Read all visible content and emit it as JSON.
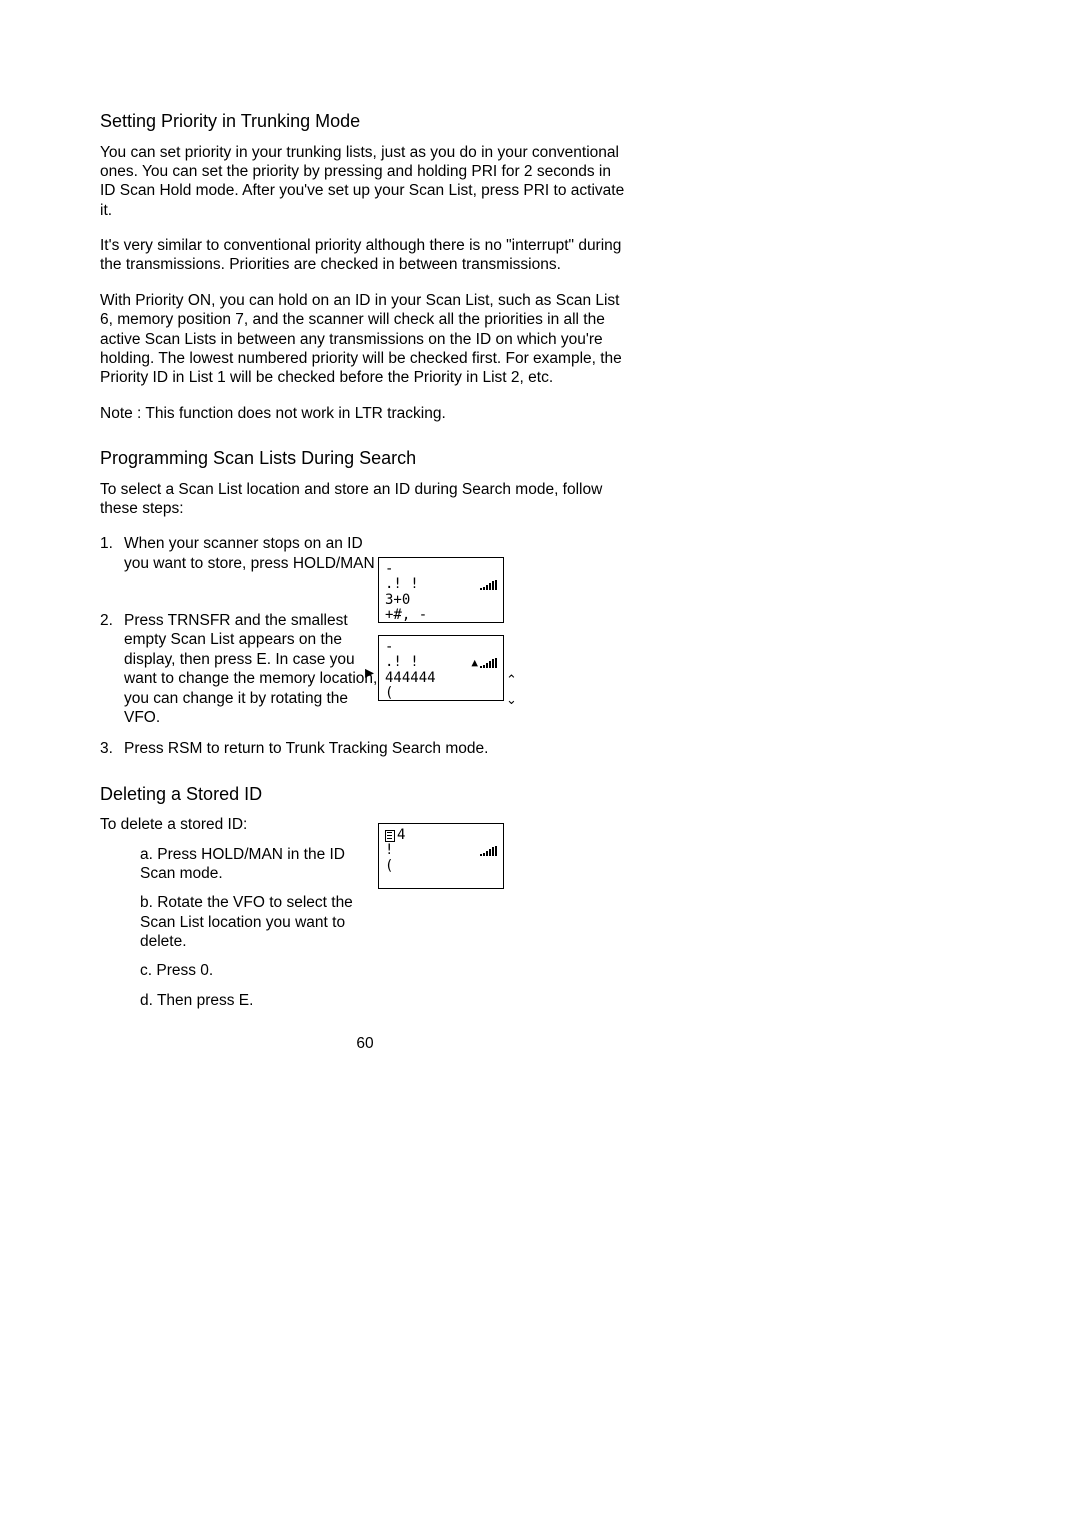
{
  "section1": {
    "heading": "Setting Priority in Trunking Mode",
    "para1": "You can set priority in your trunking lists, just as you do in your conventional ones. You can set the priority by pressing and holding PRI for 2 seconds in ID Scan Hold mode. After you've set up your Scan List, press PRI to activate it.",
    "para2": "It's very similar to conventional priority although there is no \"interrupt\" during the transmissions. Priorities are checked in between transmissions.",
    "para3": "With Priority ON, you can hold on an ID in your Scan List, such as Scan List 6, memory position 7, and the scanner will check all the priorities in all the active Scan Lists in between any transmissions on the ID on which you're holding. The lowest numbered priority will be checked first. For example, the Priority ID in List 1 will be checked before the Priority in List 2, etc.",
    "note": "Note :  This function does not work in LTR tracking."
  },
  "section2": {
    "heading": "Programming Scan Lists During Search",
    "intro": "To select a Scan List location and store an ID during Search mode, follow these steps:",
    "steps": {
      "n1": "1.",
      "s1": "When your scanner stops on an ID you want to store, press HOLD/MAN .",
      "n2": "2.",
      "s2": "Press TRNSFR and the smallest empty Scan List appears on the display, then press E. In case you want to change the memory location, you can change it by rotating the VFO.",
      "n3": "3.",
      "s3": "Press RSM to return to Trunk Tracking Search mode."
    }
  },
  "section3": {
    "heading": "Deleting a Stored ID",
    "intro": "To delete a stored ID:",
    "a": "a. Press HOLD/MAN  in the ID Scan mode.",
    "b": "b. Rotate the VFO to select the Scan List location you want to delete.",
    "c": "c. Press 0.",
    "d": "d. Then press E."
  },
  "display1": {
    "line1": "-",
    "line2": ".!   !",
    "line3": " 3+0",
    "line4": "+#,  -"
  },
  "display2": {
    "line1": "-",
    "line2": ".!   !",
    "line3": "   444444",
    "line4": "    ("
  },
  "display3": {
    "line1": "   4",
    "line2": "    !",
    "line3": " ",
    "line4": "    ("
  },
  "pagenum": "60"
}
